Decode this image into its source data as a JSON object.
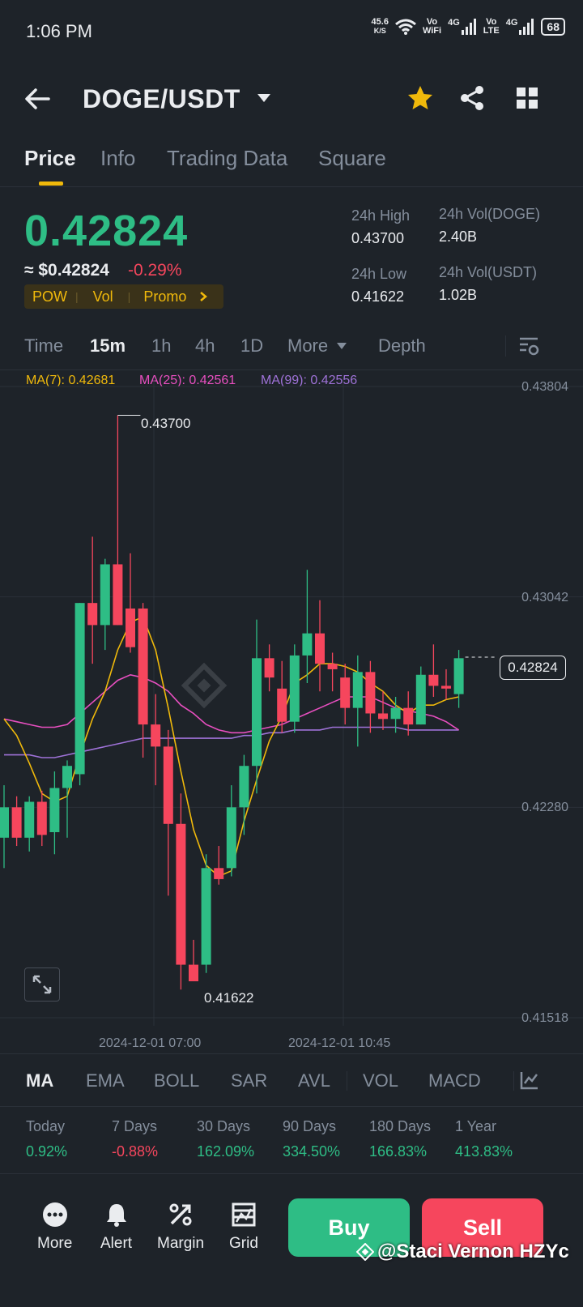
{
  "status": {
    "time": "1:06 PM",
    "net_speed_value": "45.6",
    "net_speed_unit": "K/S",
    "vo_wifi": [
      "Vo",
      "WiFi"
    ],
    "net1": "4G",
    "vo_lte": [
      "Vo",
      "LTE"
    ],
    "net2": "4G",
    "battery": "68"
  },
  "header": {
    "pair": "DOGE/USDT"
  },
  "tabs": [
    {
      "label": "Price",
      "active": true
    },
    {
      "label": "Info"
    },
    {
      "label": "Trading Data"
    },
    {
      "label": "Square"
    }
  ],
  "ticker": {
    "last_price": "0.42824",
    "usd_price": "≈ $0.42824",
    "change": "-0.29%",
    "tags": [
      "POW",
      "Vol",
      "Promo"
    ],
    "high_label": "24h High",
    "high": "0.43700",
    "low_label": "24h Low",
    "low": "0.41622",
    "vol_doge_label": "24h Vol(DOGE)",
    "vol_doge": "2.40B",
    "vol_usdt_label": "24h Vol(USDT)",
    "vol_usdt": "1.02B"
  },
  "timeframes": [
    "Time",
    "15m",
    "1h",
    "4h",
    "1D",
    "More",
    "Depth"
  ],
  "active_timeframe": "15m",
  "ma_legend": {
    "ma7": "MA(7): 0.42681",
    "ma25": "MA(25): 0.42561",
    "ma99": "MA(99): 0.42556"
  },
  "colors": {
    "up": "#2ebd85",
    "down": "#f6465d",
    "ma7": "#f0b90b",
    "ma25": "#e84fc0",
    "ma99": "#9f72d8",
    "accent": "#f0b90b",
    "bg": "#1e2329"
  },
  "chart_data": {
    "type": "candlestick",
    "ylim": [
      0.41518,
      0.43804
    ],
    "price_ticks": [
      "0.43804",
      "0.43042",
      "0.42280",
      "0.41518"
    ],
    "time_ticks": [
      "2024-12-01 07:00",
      "2024-12-01 10:45"
    ],
    "high_marker": "0.43700",
    "low_marker": "0.41622",
    "current_price": "0.42824",
    "candles": [
      {
        "o": 0.4217,
        "h": 0.4236,
        "l": 0.4206,
        "c": 0.4228
      },
      {
        "o": 0.4228,
        "h": 0.4232,
        "l": 0.4214,
        "c": 0.4217
      },
      {
        "o": 0.4217,
        "h": 0.4232,
        "l": 0.4212,
        "c": 0.423
      },
      {
        "o": 0.423,
        "h": 0.4234,
        "l": 0.4214,
        "c": 0.4218
      },
      {
        "o": 0.4219,
        "h": 0.4241,
        "l": 0.4211,
        "c": 0.4235
      },
      {
        "o": 0.4235,
        "h": 0.4245,
        "l": 0.4217,
        "c": 0.4243
      },
      {
        "o": 0.424,
        "h": 0.4278,
        "l": 0.4236,
        "c": 0.4302
      },
      {
        "o": 0.4302,
        "h": 0.4326,
        "l": 0.428,
        "c": 0.4294
      },
      {
        "o": 0.4294,
        "h": 0.4318,
        "l": 0.4285,
        "c": 0.4316
      },
      {
        "o": 0.4316,
        "h": 0.437,
        "l": 0.4299,
        "c": 0.4294
      },
      {
        "o": 0.43,
        "h": 0.432,
        "l": 0.4284,
        "c": 0.4286
      },
      {
        "o": 0.43,
        "h": 0.4302,
        "l": 0.4246,
        "c": 0.4258
      },
      {
        "o": 0.4258,
        "h": 0.4269,
        "l": 0.4236,
        "c": 0.425
      },
      {
        "o": 0.425,
        "h": 0.4256,
        "l": 0.4196,
        "c": 0.4222
      },
      {
        "o": 0.4222,
        "h": 0.4233,
        "l": 0.4162,
        "c": 0.4171
      },
      {
        "o": 0.4171,
        "h": 0.418,
        "l": 0.4166,
        "c": 0.4165
      },
      {
        "o": 0.4171,
        "h": 0.4211,
        "l": 0.4168,
        "c": 0.4206
      },
      {
        "o": 0.4206,
        "h": 0.4214,
        "l": 0.42,
        "c": 0.4202
      },
      {
        "o": 0.4206,
        "h": 0.4236,
        "l": 0.4203,
        "c": 0.4228
      },
      {
        "o": 0.4228,
        "h": 0.4247,
        "l": 0.4218,
        "c": 0.4243
      },
      {
        "o": 0.4243,
        "h": 0.4296,
        "l": 0.4233,
        "c": 0.4282
      },
      {
        "o": 0.4282,
        "h": 0.4287,
        "l": 0.427,
        "c": 0.4275
      },
      {
        "o": 0.4271,
        "h": 0.4281,
        "l": 0.4255,
        "c": 0.4259
      },
      {
        "o": 0.4259,
        "h": 0.4287,
        "l": 0.4255,
        "c": 0.4283
      },
      {
        "o": 0.4283,
        "h": 0.4314,
        "l": 0.4273,
        "c": 0.4291
      },
      {
        "o": 0.4291,
        "h": 0.4303,
        "l": 0.427,
        "c": 0.428
      },
      {
        "o": 0.428,
        "h": 0.4284,
        "l": 0.427,
        "c": 0.4278
      },
      {
        "o": 0.4275,
        "h": 0.428,
        "l": 0.4258,
        "c": 0.4264
      },
      {
        "o": 0.4264,
        "h": 0.4283,
        "l": 0.425,
        "c": 0.4277
      },
      {
        "o": 0.4277,
        "h": 0.4281,
        "l": 0.4255,
        "c": 0.4262
      },
      {
        "o": 0.4262,
        "h": 0.427,
        "l": 0.4256,
        "c": 0.426
      },
      {
        "o": 0.426,
        "h": 0.4268,
        "l": 0.4255,
        "c": 0.4264
      },
      {
        "o": 0.4264,
        "h": 0.427,
        "l": 0.4254,
        "c": 0.4258
      },
      {
        "o": 0.4258,
        "h": 0.4279,
        "l": 0.4258,
        "c": 0.4276
      },
      {
        "o": 0.4276,
        "h": 0.4287,
        "l": 0.4268,
        "c": 0.4272
      },
      {
        "o": 0.4272,
        "h": 0.4278,
        "l": 0.4267,
        "c": 0.4271
      },
      {
        "o": 0.4269,
        "h": 0.4285,
        "l": 0.4264,
        "c": 0.4282
      }
    ],
    "ma7": [
      0.426,
      0.4254,
      0.4244,
      0.4233,
      0.423,
      0.4232,
      0.4247,
      0.426,
      0.427,
      0.4285,
      0.4295,
      0.4297,
      0.4285,
      0.4264,
      0.4241,
      0.422,
      0.4207,
      0.4203,
      0.4205,
      0.4223,
      0.4238,
      0.4252,
      0.4261,
      0.4273,
      0.4276,
      0.428,
      0.428,
      0.4279,
      0.4277,
      0.4273,
      0.427,
      0.4265,
      0.4262,
      0.4265,
      0.4265,
      0.4267,
      0.4268
    ],
    "ma25": [
      0.426,
      0.4259,
      0.4258,
      0.4257,
      0.4257,
      0.4258,
      0.4262,
      0.4266,
      0.427,
      0.4274,
      0.4276,
      0.4275,
      0.4273,
      0.427,
      0.4265,
      0.4262,
      0.4258,
      0.4256,
      0.4255,
      0.4255,
      0.4256,
      0.4257,
      0.4258,
      0.426,
      0.4262,
      0.4264,
      0.4266,
      0.4268,
      0.4268,
      0.4268,
      0.4266,
      0.4264,
      0.4263,
      0.4262,
      0.4261,
      0.4259,
      0.4256
    ],
    "ma99": [
      0.4247,
      0.4247,
      0.4247,
      0.4246,
      0.4246,
      0.4247,
      0.4248,
      0.4249,
      0.425,
      0.4251,
      0.4252,
      0.4253,
      0.4253,
      0.4253,
      0.4253,
      0.4253,
      0.4253,
      0.4253,
      0.4253,
      0.4254,
      0.4254,
      0.4255,
      0.4255,
      0.4256,
      0.4256,
      0.4256,
      0.4257,
      0.4257,
      0.4257,
      0.4257,
      0.4257,
      0.4257,
      0.4256,
      0.4256,
      0.4256,
      0.4256,
      0.4256
    ]
  },
  "indicators": [
    "MA",
    "EMA",
    "BOLL",
    "SAR",
    "AVL",
    "VOL",
    "MACD"
  ],
  "performance": [
    {
      "label": "Today",
      "value": "0.92%",
      "dir": "up"
    },
    {
      "label": "7 Days",
      "value": "-0.88%",
      "dir": "down"
    },
    {
      "label": "30 Days",
      "value": "162.09%",
      "dir": "up"
    },
    {
      "label": "90 Days",
      "value": "334.50%",
      "dir": "up"
    },
    {
      "label": "180 Days",
      "value": "166.83%",
      "dir": "up"
    },
    {
      "label": "1 Year",
      "value": "413.83%",
      "dir": "up"
    }
  ],
  "bottom_nav": [
    {
      "label": "More",
      "icon": "more-icon"
    },
    {
      "label": "Alert",
      "icon": "bell-icon"
    },
    {
      "label": "Margin",
      "icon": "margin-icon"
    },
    {
      "label": "Grid",
      "icon": "grid-trading-icon"
    }
  ],
  "actions": {
    "buy": "Buy",
    "sell": "Sell"
  },
  "watermark": "@Staci Vernon HZYc"
}
